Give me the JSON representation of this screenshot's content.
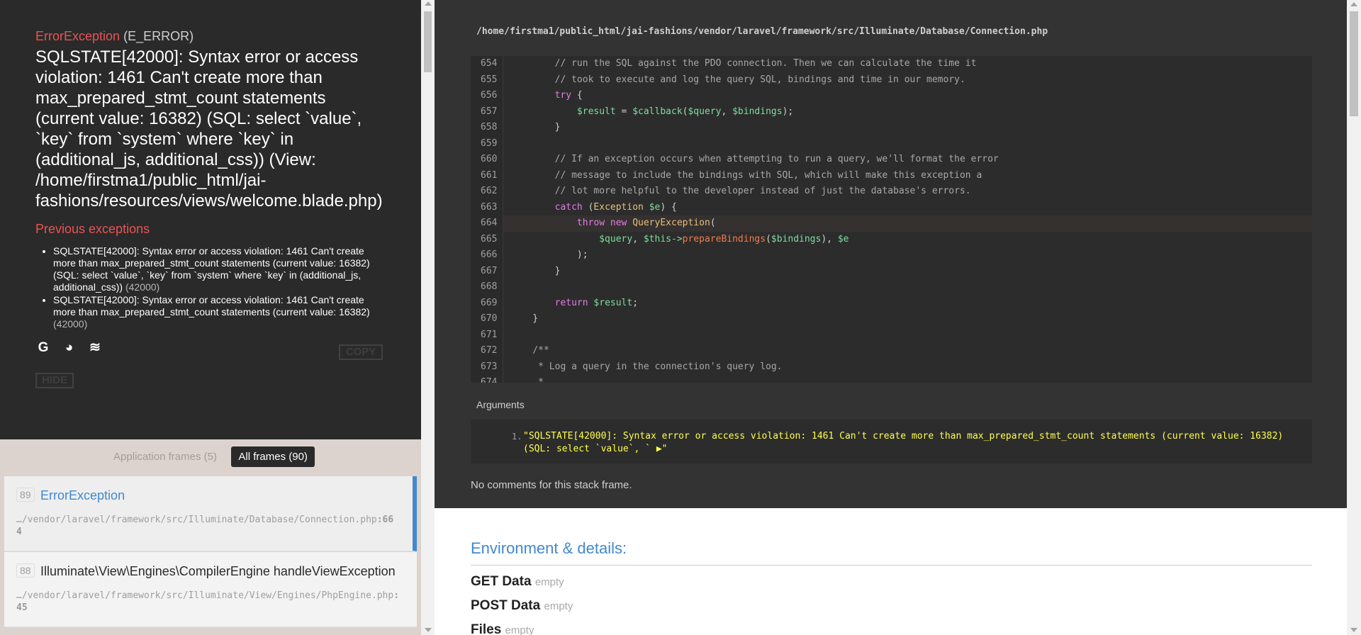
{
  "exception": {
    "class": "ErrorException",
    "code": "(E_ERROR)",
    "message": "SQLSTATE[42000]: Syntax error or access violation: 1461 Can't create more than max_prepared_stmt_count statements (current value: 16382) (SQL: select `value`, `key` from `system` where `key` in (additional_js, additional_css)) (View: /home/firstma1/public_html/jai-fashions/resources/views/welcome.blade.php)"
  },
  "previous": {
    "title": "Previous exceptions",
    "items": [
      {
        "text": "SQLSTATE[42000]: Syntax error or access violation: 1461 Can't create more than max_prepared_stmt_count statements (current value: 16382) (SQL: select `value`, `key` from `system` where `key` in (additional_js, additional_css))",
        "code": "(42000)"
      },
      {
        "text": "SQLSTATE[42000]: Syntax error or access violation: 1461 Can't create more than max_prepared_stmt_count statements (current value: 16382)",
        "code": "(42000)"
      }
    ]
  },
  "search_icons": [
    {
      "name": "google-icon",
      "glyph": "G"
    },
    {
      "name": "duckduckgo-icon",
      "glyph": "◕"
    },
    {
      "name": "stackoverflow-icon",
      "glyph": "≋"
    }
  ],
  "buttons": {
    "copy": "COPY",
    "hide": "HIDE"
  },
  "frame_tabs": {
    "application": "Application frames (5)",
    "all": "All frames (90)"
  },
  "frames": [
    {
      "index": "89",
      "class": "ErrorException",
      "file": "…/vendor/laravel/framework/src/Illuminate/Database/Connection.php",
      "line": ":664"
    },
    {
      "index": "88",
      "class": "Illuminate\\View\\Engines\\CompilerEngine handleViewException",
      "file": "…/vendor/laravel/framework/src/Illuminate/View/Engines/PhpEngine.php",
      "line": ":45"
    }
  ],
  "code": {
    "filepath": "/home/firstma1/public_html/jai-fashions/vendor/laravel/framework/src/Illuminate/Database/Connection.php",
    "lines": [
      {
        "n": "654",
        "t": "        // run the SQL against the PDO connection. Then we can calculate the time it"
      },
      {
        "n": "655",
        "t": "        // took to execute and log the query SQL, bindings and time in our memory."
      },
      {
        "n": "656",
        "t": "        try {"
      },
      {
        "n": "657",
        "t": "            $result = $callback($query, $bindings);"
      },
      {
        "n": "658",
        "t": "        }"
      },
      {
        "n": "659",
        "t": ""
      },
      {
        "n": "660",
        "t": "        // If an exception occurs when attempting to run a query, we'll format the error"
      },
      {
        "n": "661",
        "t": "        // message to include the bindings with SQL, which will make this exception a"
      },
      {
        "n": "662",
        "t": "        // lot more helpful to the developer instead of just the database's errors."
      },
      {
        "n": "663",
        "t": "        catch (Exception $e) {"
      },
      {
        "n": "664",
        "t": "            throw new QueryException("
      },
      {
        "n": "665",
        "t": "                $query, $this->prepareBindings($bindings), $e"
      },
      {
        "n": "666",
        "t": "            );"
      },
      {
        "n": "667",
        "t": "        }"
      },
      {
        "n": "668",
        "t": ""
      },
      {
        "n": "669",
        "t": "        return $result;"
      },
      {
        "n": "670",
        "t": "    }"
      },
      {
        "n": "671",
        "t": ""
      },
      {
        "n": "672",
        "t": "    /**"
      },
      {
        "n": "673",
        "t": "     * Log a query in the connection's query log."
      },
      {
        "n": "674",
        "t": "     *"
      }
    ],
    "highlight": "664"
  },
  "arguments": {
    "title": "Arguments",
    "num": "1.",
    "value": "\"SQLSTATE[42000]: Syntax error or access violation: 1461 Can't create more than max_prepared_stmt_count statements (current value: 16382) (SQL: select `value`, ` ▶\""
  },
  "no_comments": "No comments for this stack frame.",
  "environment": {
    "title": "Environment & details:",
    "rows": [
      {
        "label": "GET Data",
        "value": "empty"
      },
      {
        "label": "POST Data",
        "value": "empty"
      },
      {
        "label": "Files",
        "value": "empty"
      }
    ]
  },
  "colors": {
    "accent_red": "#e95353",
    "accent_blue": "#4288ce",
    "panel_dark": "#2a2a2a",
    "code_bg": "#333333"
  }
}
